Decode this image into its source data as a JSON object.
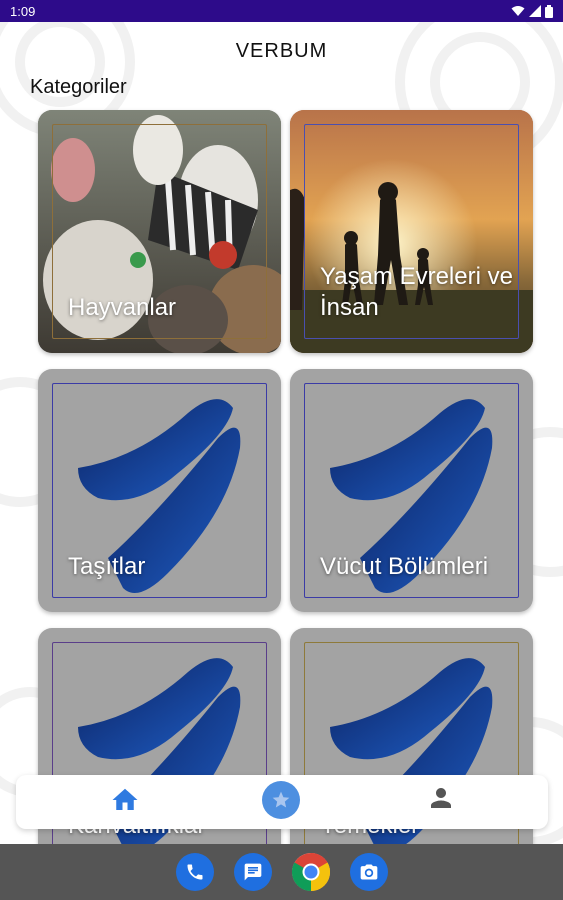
{
  "status_bar": {
    "time": "1:09"
  },
  "header": {
    "title": "VERBUM"
  },
  "section": {
    "title": "Kategoriler"
  },
  "categories": [
    {
      "label": "Hayvanlar",
      "image": "animals-photo"
    },
    {
      "label": "Yaşam Evreleri ve İnsan",
      "image": "family-sunset-photo"
    },
    {
      "label": "Taşıtlar",
      "image": "verbum-logo"
    },
    {
      "label": "Vücut Bölümleri",
      "image": "verbum-logo"
    },
    {
      "label": "Kıyafetler / Kahvaltılıklar",
      "image": "verbum-logo"
    },
    {
      "label": "Yemekler",
      "image": "verbum-logo"
    }
  ],
  "bottom_nav": {
    "items": [
      "home-icon",
      "star-icon",
      "person-icon"
    ]
  },
  "colors": {
    "accent": "#2d0b8a",
    "fab": "#4d8fe0",
    "home": "#2f7ae0",
    "logo_dark": "#0b1f5c",
    "logo_light": "#1f5fc7"
  }
}
